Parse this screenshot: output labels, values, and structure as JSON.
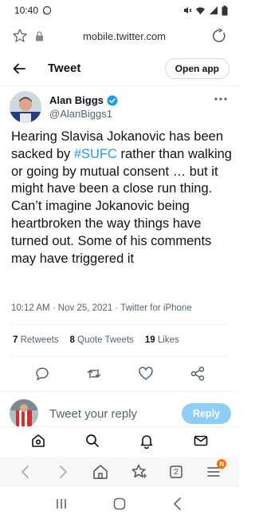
{
  "status_bar": {
    "time": "10:40"
  },
  "browser": {
    "url": "mobile.twitter.com"
  },
  "header": {
    "title": "Tweet",
    "open_app_label": "Open app"
  },
  "tweet": {
    "author_name": "Alan Biggs",
    "author_handle": "@AlanBiggs1",
    "text_before": "Hearing Slavisa Jokanovic has been sacked by ",
    "hashtag": "#SUFC",
    "text_after": " rather than walking or going by mutual consent … but it might have been a close run thing. Can’t imagine Jokanovic being heartbroken the way things have turned out. Some of his comments may have triggered it",
    "meta": "10:12 AM · Nov 25, 2021 · Twitter for iPhone"
  },
  "stats": {
    "retweets_count": "7",
    "retweets_label": "Retweets",
    "quotes_count": "8",
    "quotes_label": "Quote Tweets",
    "likes_count": "19",
    "likes_label": "Likes"
  },
  "reply": {
    "placeholder": "Tweet your reply",
    "button_label": "Reply"
  },
  "browser_nav": {
    "tabs_count": "2",
    "badge": "N"
  },
  "colors": {
    "accent": "#1d9bf0",
    "reply_button": "#8ecdf7",
    "badge": "#ff6d00"
  }
}
